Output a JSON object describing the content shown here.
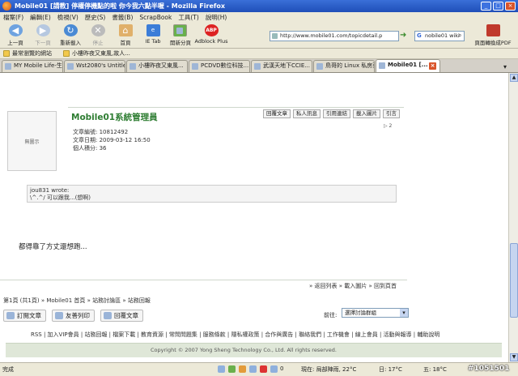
{
  "window": {
    "title": "Mobile01 [請教] 停權停機點的啦 你今我六點半喔 - Mozilla Firefox",
    "controls": [
      "_",
      "□",
      "×"
    ]
  },
  "menu": [
    "檔案(F)",
    "編輯(E)",
    "檢視(V)",
    "歷史(S)",
    "書籤(B)",
    "ScrapBook",
    "工具(T)",
    "說明(H)"
  ],
  "toolbar": {
    "back": "上一頁",
    "forward": "下一頁",
    "reload": "重新載入",
    "stop": "停止",
    "home": "首頁",
    "ie_tab": "IE Tab",
    "split": "開新分頁",
    "adblock": "Adblock Plus",
    "url": "http://www.mobile01.com/topicdetail.p",
    "search_value": "nobile01 wiki",
    "pdf": "頁面轉換成PDF"
  },
  "bookmarks": [
    "最常瀏覽的網站",
    "小樓昨夜又東風,故人..."
  ],
  "tabs": [
    "MY Mobile Life-生...",
    "Wst2080's Untitled",
    "小樓昨夜又東風...",
    "PCDVD數位科技...",
    "武漢天地下CCIE...",
    "鳥哥的 Linux 私房菜",
    "Mobile01 [..."
  ],
  "post": {
    "avatar_text": "無圖示",
    "poster": "Mobile01系統管理員",
    "actions": [
      "回覆文章",
      "私人訊息",
      "引用連結",
      "載入圖片",
      "引言"
    ],
    "pager_small": "▷ 2",
    "info": [
      "文章編號: 10812492",
      "文章日期: 2009-03-12 16:50",
      "個人積分: 36"
    ],
    "quote_author": "jou831 wrote:",
    "quote_text": "\\^.^/ 可以跟我...(想啊)",
    "body": "都得靠了方丈還想跑...",
    "links": "» 返回列表 » 載入圖片 » 回到頁首"
  },
  "breadcrumb": "第1頁 (共1頁) » Mobile01 首頁 » 站務討論區 » 站務回報",
  "bottom_buttons": [
    "訂閱文章",
    "友善列印",
    "回覆文章"
  ],
  "goto": {
    "label": "前往:",
    "selected": "選擇討論群組"
  },
  "footer": {
    "links": "RSS | 加入VIP會員 | 站務回報 | 檔案下載 | 教育資源 | 常問問題集 | 服務條款 | 隱私權政策 | 合作與廣告 | 聯絡我們 | 工作機會 | 線上會員 | 活動與報導 | 輔助說明",
    "copyright": "Copyright © 2007 Yong Sheng Technology Co., Ltd. All rights reserved."
  },
  "status": {
    "done": "完成",
    "mail": "0",
    "weather_now": "現在: 局部陣雨, 22°C",
    "temp_now": "日: 17°C",
    "temp_day": "五: 18°C"
  },
  "watermark": "#1051501"
}
